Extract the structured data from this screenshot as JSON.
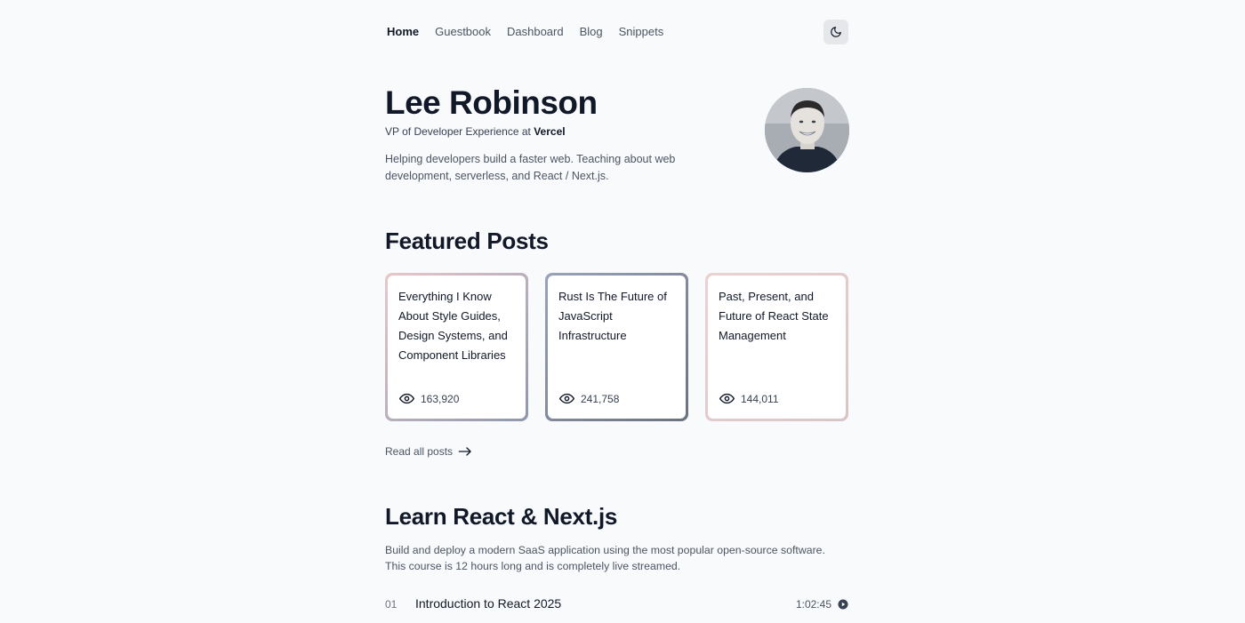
{
  "nav": {
    "items": [
      {
        "label": "Home",
        "active": true
      },
      {
        "label": "Guestbook",
        "active": false
      },
      {
        "label": "Dashboard",
        "active": false
      },
      {
        "label": "Blog",
        "active": false
      },
      {
        "label": "Snippets",
        "active": false
      }
    ],
    "theme_icon": "moon-icon"
  },
  "hero": {
    "name": "Lee Robinson",
    "role_prefix": "VP of Developer Experience at ",
    "company": "Vercel",
    "tagline": "Helping developers build a faster web. Teaching about web development, serverless, and React / Next.js."
  },
  "featured": {
    "title": "Featured Posts",
    "posts": [
      {
        "title": "Everything I Know About Style Guides, Design Systems, and Component Libraries",
        "views": "163,920",
        "border_from": "#e8c8cc",
        "border_to": "#8e97ad"
      },
      {
        "title": "Rust Is The Future of JavaScript Infrastructure",
        "views": "241,758",
        "border_from": "#9aa3b8",
        "border_to": "#6b7280"
      },
      {
        "title": "Past, Present, and Future of React State Management",
        "views": "144,011",
        "border_from": "#ead2d2",
        "border_to": "#d8c6c6"
      }
    ],
    "read_all": "Read all posts"
  },
  "course": {
    "title": "Learn React & Next.js",
    "description": "Build and deploy a modern SaaS application using the most popular open-source software. This course is 12 hours long and is completely live streamed.",
    "lessons": [
      {
        "number": "01",
        "title": "Introduction to React 2025",
        "duration": "1:02:45"
      }
    ]
  }
}
